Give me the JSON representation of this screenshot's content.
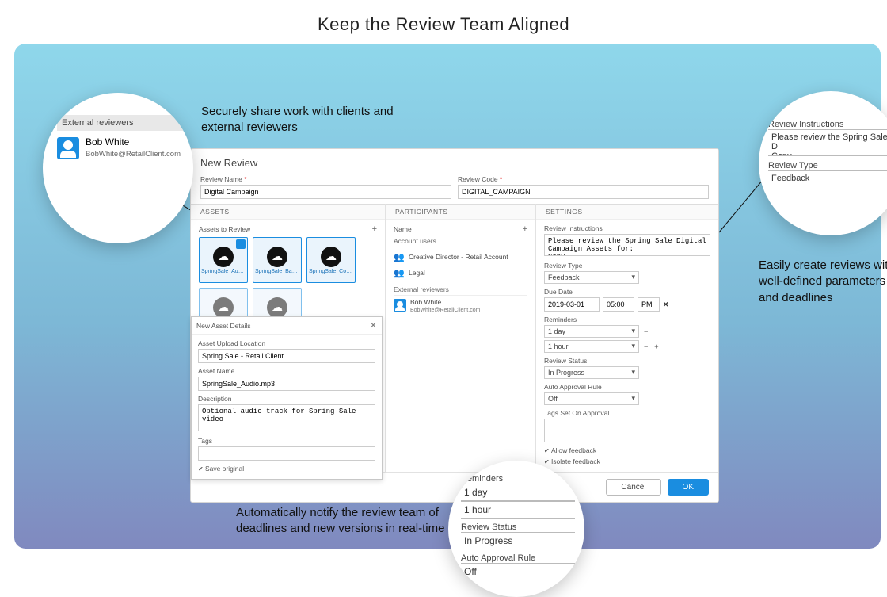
{
  "page_title": "Keep the Review Team Aligned",
  "captions": {
    "share": "Securely share work with clients and external reviewers",
    "params": "Easily create reviews with well-defined parameters and deadlines",
    "notify": "Automatically notify the review team of deadlines and new versions in real-time"
  },
  "dialog": {
    "title": "New Review",
    "review_name_label": "Review Name",
    "review_name_value": "Digital Campaign",
    "review_code_label": "Review Code",
    "review_code_value": "DIGITAL_CAMPAIGN",
    "section_assets": "ASSETS",
    "section_participants": "PARTICIPANTS",
    "section_settings": "SETTINGS",
    "assets_header": "Assets to Review",
    "assets": [
      {
        "name": "SpringSale_Aud..."
      },
      {
        "name": "SpringSale_Ban..."
      },
      {
        "name": "SpringSale_Cop..."
      }
    ],
    "asset_details": {
      "title": "New Asset Details",
      "upload_loc_label": "Asset Upload Location",
      "upload_loc_value": "Spring Sale - Retail Client",
      "asset_name_label": "Asset Name",
      "asset_name_value": "SpringSale_Audio.mp3",
      "description_label": "Description",
      "description_value": "Optional audio track for Spring Sale video",
      "tags_label": "Tags",
      "save_original": "Save original"
    },
    "participants": {
      "name_label": "Name",
      "account_users_label": "Account users",
      "users": [
        "Creative Director - Retail Account",
        "Legal"
      ],
      "external_label": "External reviewers",
      "external": {
        "name": "Bob White",
        "email": "BobWhite@RetailClient.com"
      }
    },
    "settings": {
      "instructions_label": "Review Instructions",
      "instructions_value": "Please review the Spring Sale Digital Campaign Assets for:\nCopy",
      "type_label": "Review Type",
      "type_value": "Feedback",
      "due_label": "Due Date",
      "due_date": "2019-03-01",
      "due_time": "05:00",
      "due_ampm": "PM",
      "reminders_label": "Reminders",
      "reminders": [
        "1 day",
        "1 hour"
      ],
      "status_label": "Review Status",
      "status_value": "In Progress",
      "auto_label": "Auto Approval Rule",
      "auto_value": "Off",
      "tags_label": "Tags Set On Approval",
      "allow_feedback": "Allow feedback",
      "isolate_feedback": "Isolate feedback"
    },
    "cancel": "Cancel",
    "ok": "OK"
  },
  "circle1": {
    "header": "External reviewers",
    "name": "Bob White",
    "email": "BobWhite@RetailClient.com"
  },
  "circle2": {
    "instructions_label": "Review Instructions",
    "instructions_value": "Please review the Spring Sale D\nCopy",
    "type_label": "Review Type",
    "type_value": "Feedback"
  },
  "circle3": {
    "reminders_label": "Reminders",
    "rem1": "1 day",
    "rem2": "1 hour",
    "status_label": "Review Status",
    "status_value": "In Progress",
    "auto_label": "Auto Approval Rule",
    "auto_value": "Off"
  }
}
